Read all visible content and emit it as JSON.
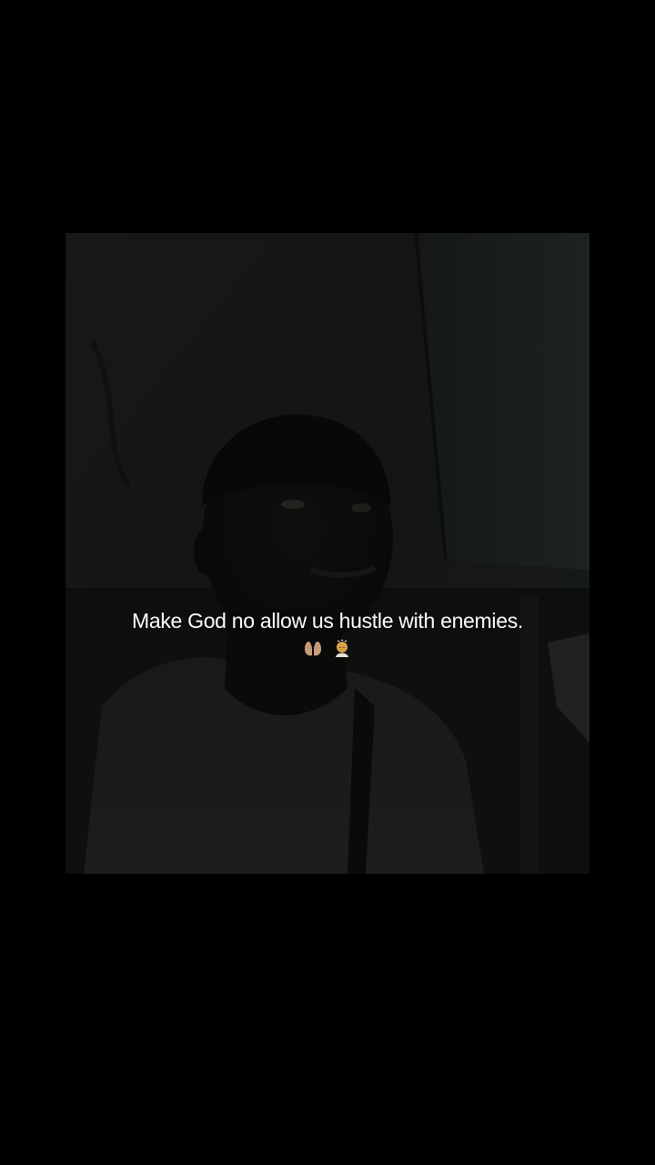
{
  "caption": {
    "text": "Make God no allow us hustle with enemies.",
    "emojis": [
      "palms-up-together-icon",
      "person-in-steamy-room-icon"
    ]
  },
  "colors": {
    "background": "#000000",
    "photo_tone": "#141714",
    "caption_text": "#ffffff"
  }
}
